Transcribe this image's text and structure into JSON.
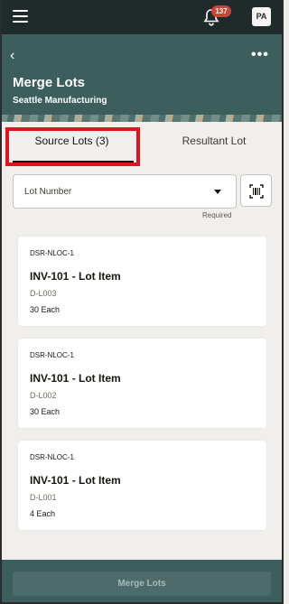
{
  "topbar": {
    "menu_icon": "hamburger-icon",
    "bell_icon": "bell-icon",
    "notification_count": "137",
    "user_initials": "PA"
  },
  "header": {
    "back_icon": "chevron-left-icon",
    "more_icon": "ellipsis-icon",
    "title": "Merge Lots",
    "subtitle": "Seattle Manufacturing"
  },
  "tabs": [
    {
      "label": "Source Lots (3)",
      "selected": true
    },
    {
      "label": "Resultant Lot",
      "selected": false
    }
  ],
  "form": {
    "lot_number_label": "Lot Number",
    "required_text": "Required",
    "scan_icon": "barcode-scan-icon"
  },
  "lots": [
    {
      "location": "DSR-NLOC-1",
      "item": "INV-101 - Lot Item",
      "lot": "D-L003",
      "quantity": "30 Each"
    },
    {
      "location": "DSR-NLOC-1",
      "item": "INV-101 - Lot Item",
      "lot": "D-L002",
      "quantity": "30 Each"
    },
    {
      "location": "DSR-NLOC-1",
      "item": "INV-101 - Lot Item",
      "lot": "D-L001",
      "quantity": "4 Each"
    }
  ],
  "footer": {
    "merge_label": "Merge Lots"
  },
  "colors": {
    "topbar": "#1f2a2b",
    "header": "#3c5e5d",
    "badge": "#c74634",
    "highlight": "#e0141a"
  }
}
